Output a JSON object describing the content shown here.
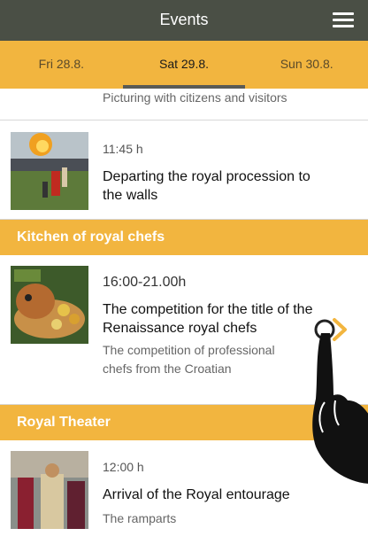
{
  "header": {
    "title": "Events"
  },
  "tabs": [
    {
      "label": "Fri 28.8.",
      "active": false
    },
    {
      "label": "Sat 29.8.",
      "active": true
    },
    {
      "label": "Sun 30.8.",
      "active": false
    }
  ],
  "events_top": [
    {
      "subtitle": "Picturing with citizens and visitors"
    },
    {
      "time": "11:45 h",
      "title": "Departing the royal procession to the walls"
    }
  ],
  "sections": [
    {
      "name": "Kitchen of royal chefs",
      "events": [
        {
          "time": "16:00-21.00h",
          "title": "The competition for the title of the Renaissance royal chefs",
          "subtitle": "The competition of professional chefs from the Croatian"
        }
      ]
    },
    {
      "name": "Royal Theater",
      "events": [
        {
          "time": "12:00 h",
          "title": "Arrival of the Royal entourage",
          "subtitle": "The ramparts"
        }
      ]
    }
  ],
  "colors": {
    "topbar": "#4a4f45",
    "accent": "#f2b53f"
  },
  "icons": {
    "menu": "hamburger-menu-icon",
    "next": "chevron-right-icon",
    "hand": "pointing-hand-icon"
  }
}
